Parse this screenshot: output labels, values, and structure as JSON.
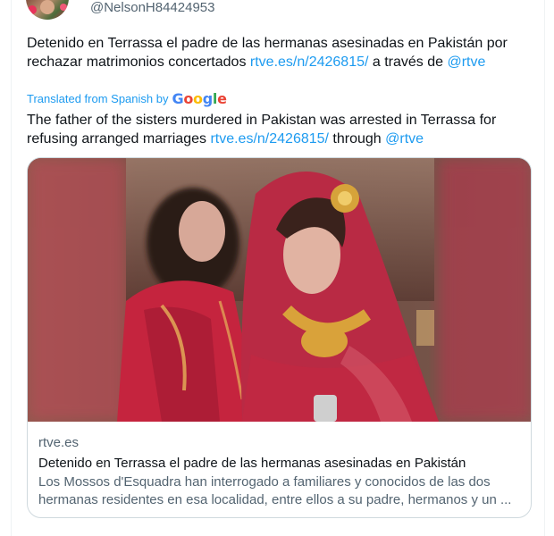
{
  "author": {
    "handle": "@NelsonH84424953"
  },
  "tweet": {
    "original_text_prefix": "Detenido en Terrassa el padre de las hermanas asesinadas en Pakistán por rechazar matrimonios concertados ",
    "original_link": "rtve.es/n/2426815/",
    "original_mid": " a través de ",
    "original_mention": "@rtve",
    "translated_label": "Translated from Spanish by",
    "google_letters": [
      "G",
      "o",
      "o",
      "g",
      "l",
      "e"
    ],
    "translated_text_prefix": "The father of the sisters murdered in Pakistan was arrested in Terrassa for refusing arranged marriages ",
    "translated_link": "rtve.es/n/2426815/",
    "translated_mid": " through ",
    "translated_mention": "@rtve"
  },
  "card": {
    "domain": "rtve.es",
    "title": "Detenido en Terrassa el padre de las hermanas asesinadas en Pakistán",
    "description": "Los Mossos d'Esquadra han interrogado a familiares y conocidos de las dos hermanas residentes en esa localidad, entre ellos a su padre, hermanos y un ..."
  },
  "colors": {
    "link": "#1d9bf0",
    "text": "#0f1419",
    "secondary": "#536471",
    "border": "#cfd9de"
  }
}
